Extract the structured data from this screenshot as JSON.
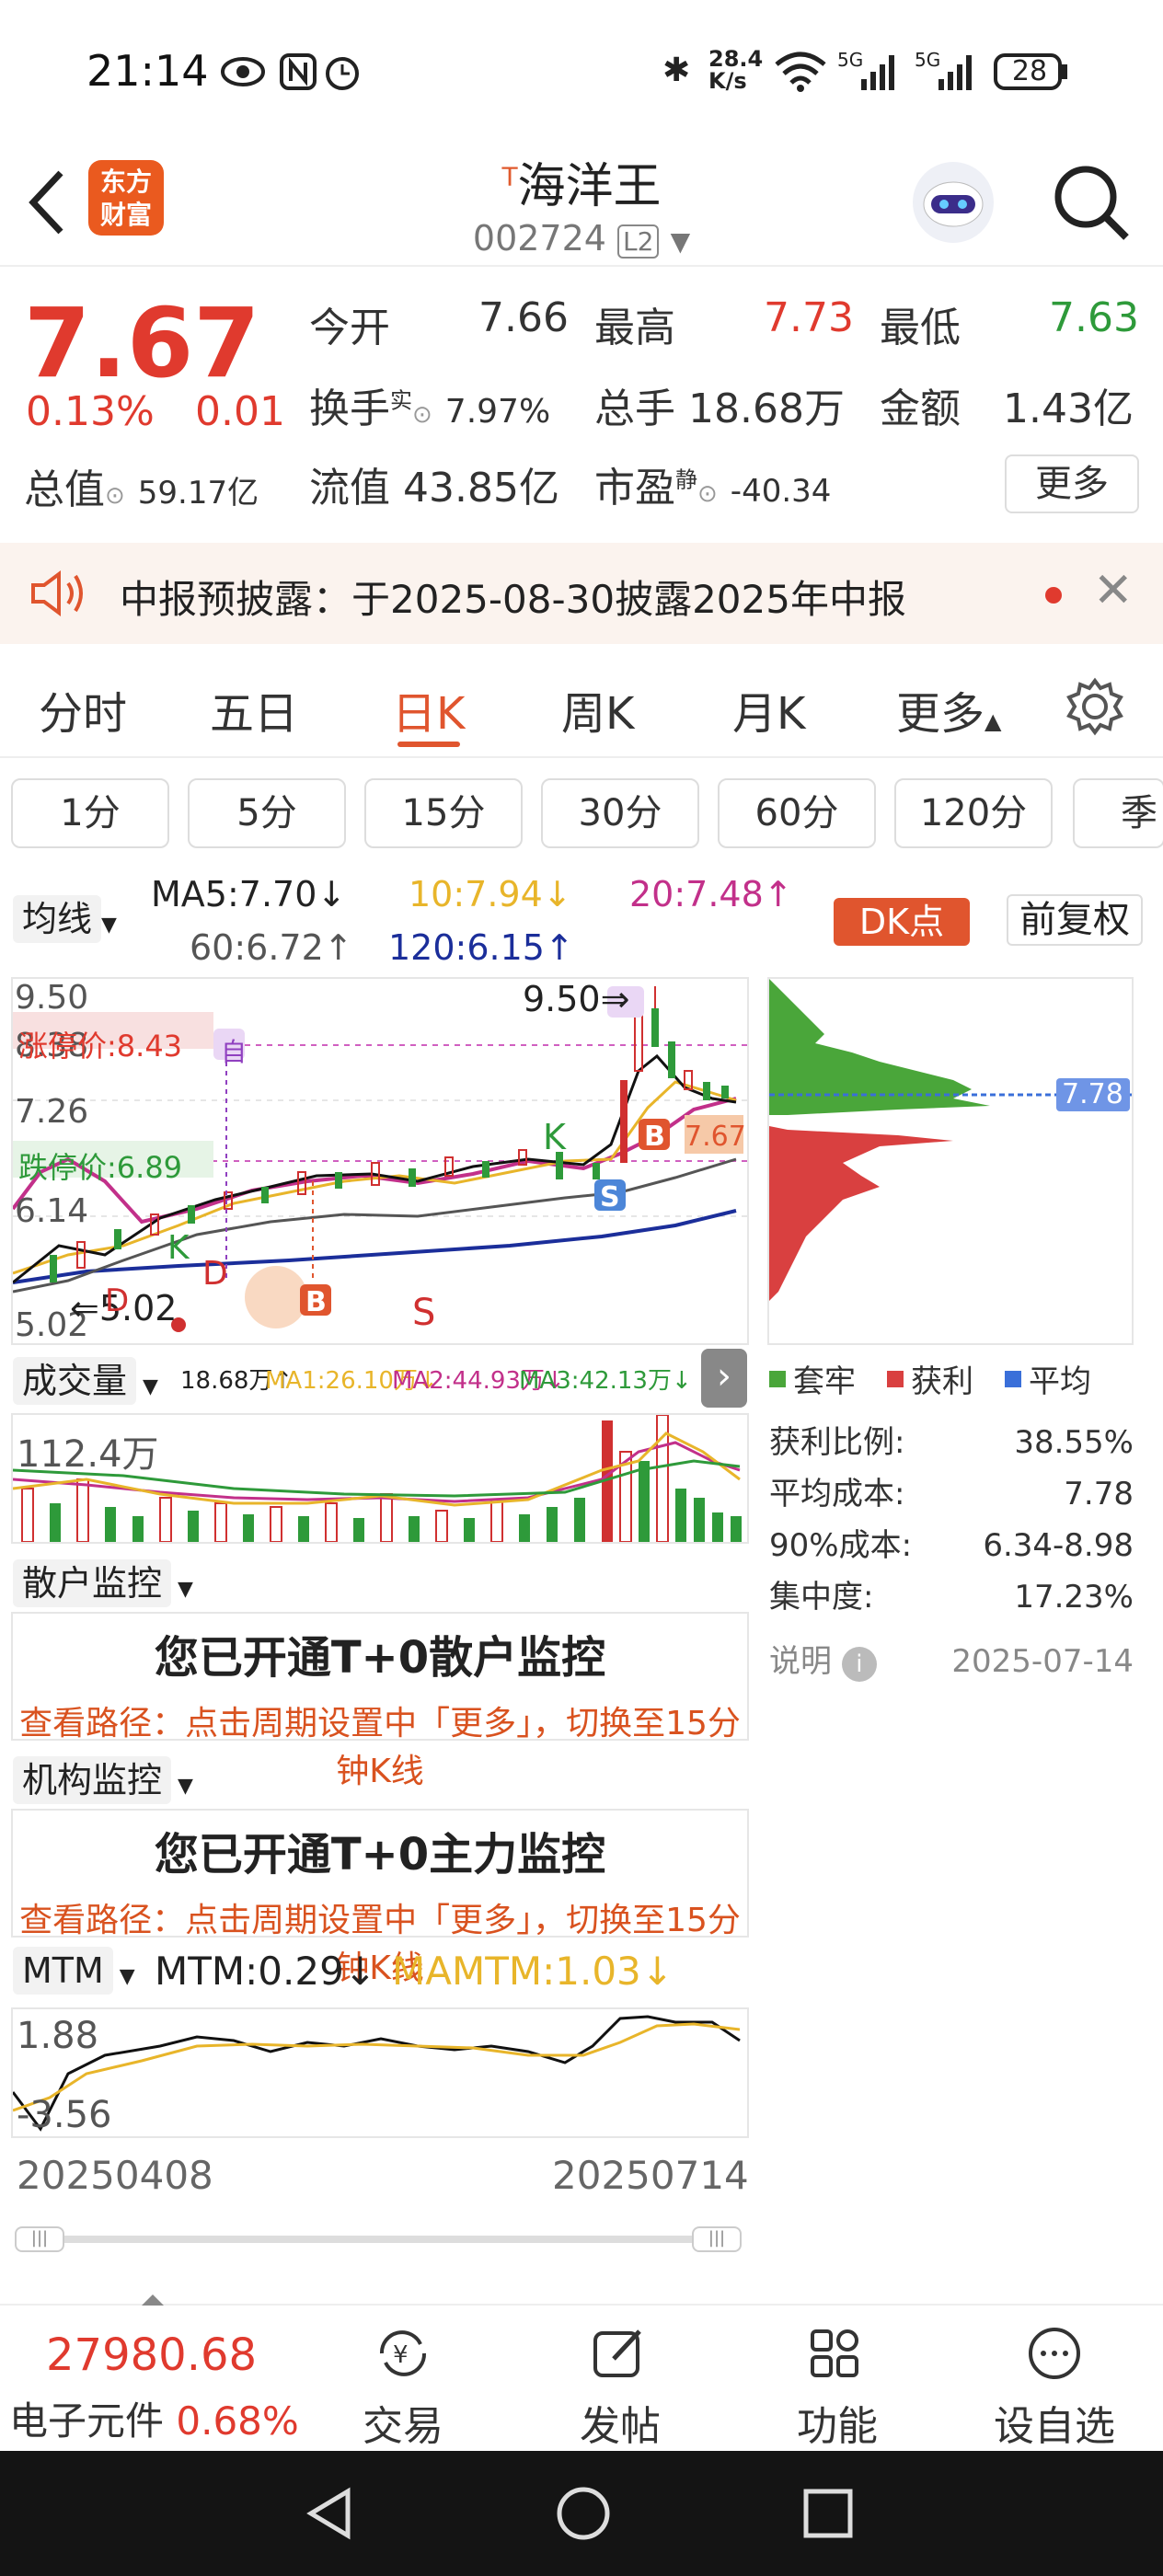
{
  "status": {
    "time": "21:14",
    "speed_top": "28.4",
    "speed_bottom": "K/s",
    "sig1": "6",
    "sig2": "5G",
    "sig3": "5G",
    "battery": "28"
  },
  "header": {
    "logo_line1": "东方",
    "logo_line2": "财富",
    "t_mark": "T",
    "name": "海洋王",
    "code": "002724",
    "level": "L2"
  },
  "quote": {
    "price": "7.67",
    "pct": "0.13%",
    "change": "0.01",
    "open_label": "今开",
    "open": "7.66",
    "high_label": "最高",
    "high": "7.73",
    "low_label": "最低",
    "low": "7.63",
    "turnover_label": "换手",
    "turnover_sup": "实",
    "turnover": "7.97%",
    "vol_label": "总手",
    "vol": "18.68万",
    "amt_label": "金额",
    "amt": "1.43亿",
    "mcap_label": "总值",
    "mcap": "59.17亿",
    "float_label": "流值",
    "float": "43.85亿",
    "pe_label": "市盈",
    "pe_sup": "静",
    "pe": "-40.34",
    "more": "更多"
  },
  "notice": {
    "text": "中报预披露：于2025-08-30披露2025年中报"
  },
  "tabs": [
    "分时",
    "五日",
    "日K",
    "周K",
    "月K",
    "更多"
  ],
  "periods": [
    "1分",
    "5分",
    "15分",
    "30分",
    "60分",
    "120分",
    "季"
  ],
  "ma": {
    "selector": "均线",
    "ma5": "MA5:7.70↓",
    "ma10": "10:7.94↓",
    "ma20": "20:7.48↑",
    "ma60": "60:6.72↑",
    "ma120": "120:6.15↑",
    "dk": "DK点",
    "fq": "前复权"
  },
  "kline": {
    "y_top": "9.50",
    "y_mid1": "8.38",
    "y_mid2": "7.26",
    "y_mid3": "6.14",
    "y_bot": "5.02",
    "limit_up": "涨停价:8.43",
    "limit_down": "跌停价:6.89",
    "high_mark": "9.50",
    "low_mark": "5.02",
    "price_tag": "7.67",
    "k_letter": "K",
    "s_letter": "S",
    "b_letter": "B",
    "d_letter": "D",
    "zi": "自"
  },
  "chip": {
    "price_tag": "7.78",
    "leg1": "套牢",
    "leg2": "获利",
    "leg3": "平均",
    "rows": [
      [
        "获利比例:",
        "38.55%"
      ],
      [
        "平均成本:",
        "7.78"
      ],
      [
        "90%成本:",
        "6.34-8.98"
      ],
      [
        "集中度:",
        "17.23%"
      ]
    ],
    "note": "说明",
    "date": "2025-07-14",
    "leg1_color": "#4aa63a",
    "leg2_color": "#d94040",
    "leg3_color": "#3a6fd9"
  },
  "volume": {
    "selector": "成交量",
    "vol": "18.68万↑",
    "ma1": "MA1:26.10万↓",
    "ma2": "MA2:44.93万↓",
    "ma3": "MA3:42.13万↓",
    "ymax": "112.4万"
  },
  "retail": {
    "selector": "散户监控",
    "title": "您已开通T+0散户监控",
    "path": "查看路径：点击周期设置中「更多」，切换至15分钟K线"
  },
  "inst": {
    "selector": "机构监控",
    "title": "您已开通T+0主力监控",
    "path": "查看路径：点击周期设置中「更多」，切换至15分钟K线"
  },
  "mtm": {
    "selector": "MTM",
    "mtm": "MTM:0.29↓",
    "mamtm": "MAMTM:1.03↓",
    "ytop": "1.88",
    "ybot": "-3.56",
    "date_start": "20250408",
    "date_end": "20250714"
  },
  "bottom": {
    "index_value": "27980.68",
    "index_name": "电子元件",
    "index_pct": "0.68%",
    "tabs": [
      "交易",
      "发帖",
      "功能",
      "设自选"
    ]
  }
}
